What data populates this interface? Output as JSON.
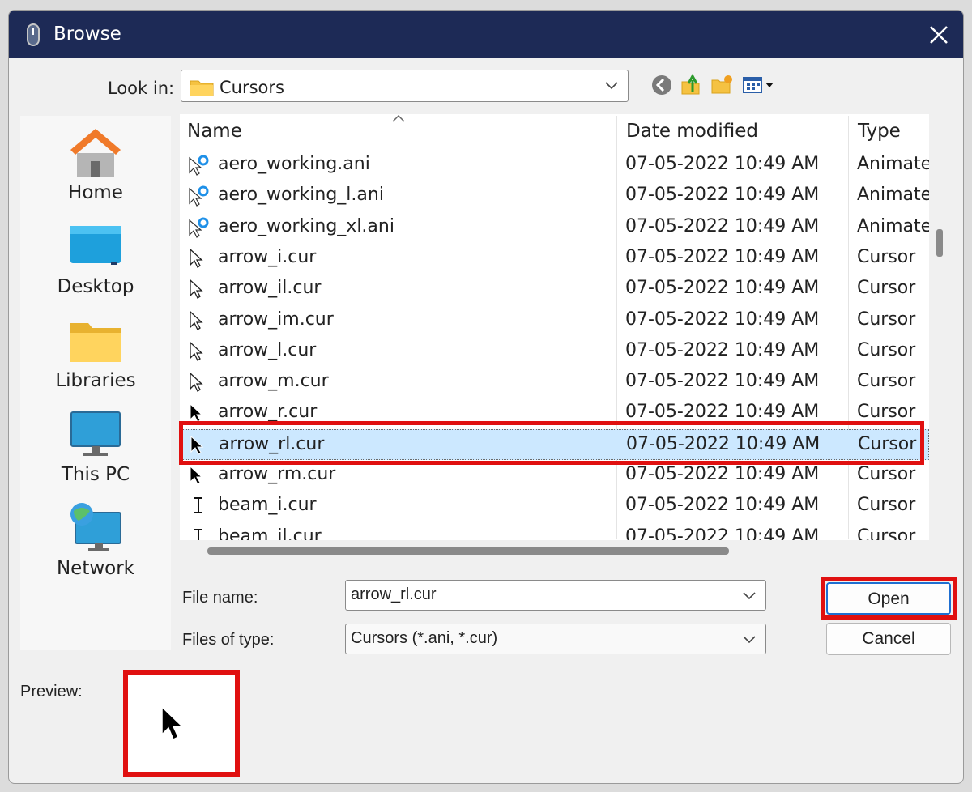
{
  "window": {
    "title": "Browse",
    "close_label": "close"
  },
  "lookin": {
    "label": "Look in:",
    "value": "Cursors"
  },
  "toolbar": {
    "icons": [
      "back-icon",
      "up-folder-icon",
      "new-folder-icon",
      "view-menu-icon"
    ]
  },
  "places": [
    {
      "label": "Home",
      "icon": "home-icon"
    },
    {
      "label": "Desktop",
      "icon": "desktop-icon"
    },
    {
      "label": "Libraries",
      "icon": "libraries-icon"
    },
    {
      "label": "This PC",
      "icon": "this-pc-icon"
    },
    {
      "label": "Network",
      "icon": "network-icon"
    }
  ],
  "columns": {
    "name": "Name",
    "date": "Date modified",
    "type": "Type"
  },
  "files": [
    {
      "name": "aero_working.ani",
      "date": "07-05-2022 10:49 AM",
      "type": "Animate",
      "icon": "busy-cursor-icon"
    },
    {
      "name": "aero_working_l.ani",
      "date": "07-05-2022 10:49 AM",
      "type": "Animate",
      "icon": "busy-cursor-icon"
    },
    {
      "name": "aero_working_xl.ani",
      "date": "07-05-2022 10:49 AM",
      "type": "Animate",
      "icon": "busy-cursor-icon"
    },
    {
      "name": "arrow_i.cur",
      "date": "07-05-2022 10:49 AM",
      "type": "Cursor",
      "icon": "arrow-outline-icon"
    },
    {
      "name": "arrow_il.cur",
      "date": "07-05-2022 10:49 AM",
      "type": "Cursor",
      "icon": "arrow-outline-icon"
    },
    {
      "name": "arrow_im.cur",
      "date": "07-05-2022 10:49 AM",
      "type": "Cursor",
      "icon": "arrow-outline-icon"
    },
    {
      "name": "arrow_l.cur",
      "date": "07-05-2022 10:49 AM",
      "type": "Cursor",
      "icon": "arrow-outline-icon"
    },
    {
      "name": "arrow_m.cur",
      "date": "07-05-2022 10:49 AM",
      "type": "Cursor",
      "icon": "arrow-outline-icon"
    },
    {
      "name": "arrow_r.cur",
      "date": "07-05-2022 10:49 AM",
      "type": "Cursor",
      "icon": "arrow-black-icon"
    },
    {
      "name": "arrow_rl.cur",
      "date": "07-05-2022 10:49 AM",
      "type": "Cursor",
      "icon": "arrow-black-icon",
      "selected": true
    },
    {
      "name": "arrow_rm.cur",
      "date": "07-05-2022 10:49 AM",
      "type": "Cursor",
      "icon": "arrow-black-icon"
    },
    {
      "name": "beam_i.cur",
      "date": "07-05-2022 10:49 AM",
      "type": "Cursor",
      "icon": "ibeam-icon"
    },
    {
      "name": "beam_il.cur",
      "date": "07-05-2022 10:49 AM",
      "type": "Cursor",
      "icon": "ibeam-icon"
    }
  ],
  "filename": {
    "label": "File name:",
    "value": "arrow_rl.cur"
  },
  "filetype": {
    "label": "Files of type:",
    "value": "Cursors (*.ani, *.cur)"
  },
  "buttons": {
    "open": "Open",
    "cancel": "Cancel"
  },
  "preview": {
    "label": "Preview:"
  }
}
